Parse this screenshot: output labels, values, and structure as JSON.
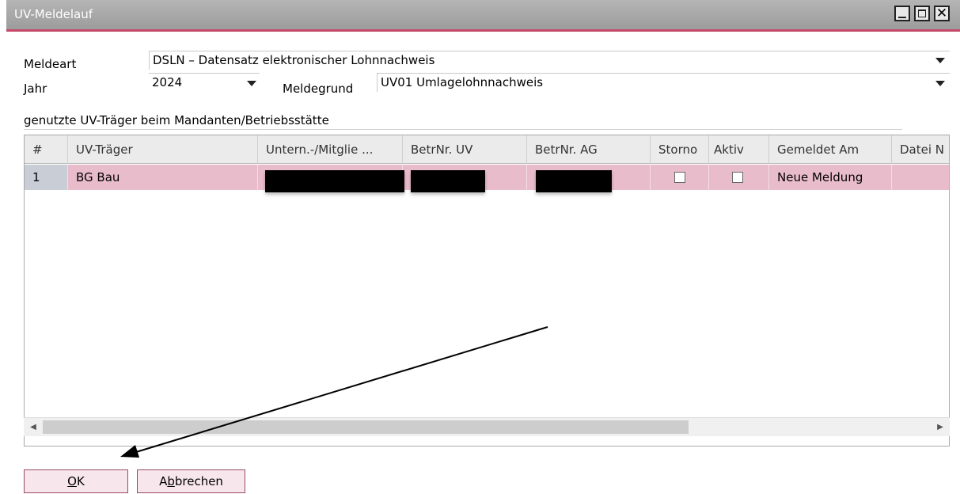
{
  "window": {
    "title": "UV-Meldelauf"
  },
  "form": {
    "meldeart_label": "Meldeart",
    "meldeart_value": "DSLN – Datensatz elektronischer Lohnnachweis",
    "jahr_label": "Jahr",
    "jahr_value": "2024",
    "meldegrund_label": "Meldegrund",
    "meldegrund_value": "UV01 Umlagelohnnachweis",
    "section_label": "genutzte UV-Träger beim Mandanten/Betriebsstätte"
  },
  "table": {
    "headers": [
      "#",
      "UV-Träger",
      "Untern.-/Mitglie ...",
      "BetrNr. UV",
      "BetrNr. AG",
      "Storno",
      "Aktiv",
      "Gemeldet Am",
      "Datei N"
    ],
    "rows": [
      {
        "num": "1",
        "traeger": "BG Bau",
        "storno": false,
        "aktiv": false,
        "gemeldet_am": "Neue Meldung"
      }
    ]
  },
  "buttons": {
    "ok": "OK",
    "ok_mnemonic": "O",
    "cancel": "Abbrechen",
    "cancel_mnemonic": "b"
  },
  "colors": {
    "accent": "#c44a6a",
    "row_selected": "#e9bccb",
    "button_border": "#9a4a62"
  }
}
